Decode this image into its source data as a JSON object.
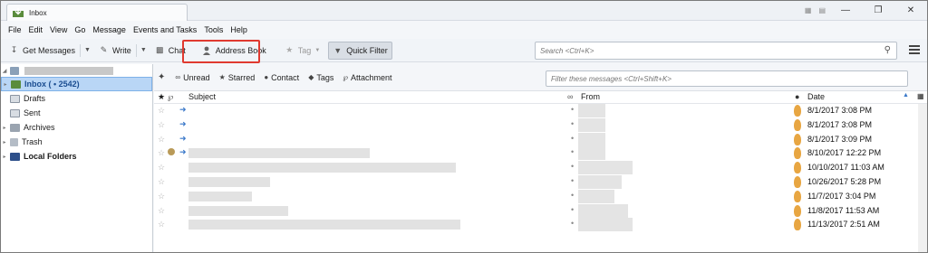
{
  "window": {
    "tab_title": "Inbox"
  },
  "menu": [
    "File",
    "Edit",
    "View",
    "Go",
    "Message",
    "Events and Tasks",
    "Tools",
    "Help"
  ],
  "toolbar": {
    "get_messages": "Get Messages",
    "write": "Write",
    "chat": "Chat",
    "address_book": "Address Book",
    "tag": "Tag",
    "quick_filter": "Quick Filter",
    "search_placeholder": "Search <Ctrl+K>"
  },
  "folders": {
    "inbox": "Inbox ( • 2542)",
    "drafts": "Drafts",
    "sent": "Sent",
    "archives": "Archives",
    "trash": "Trash",
    "local_folders": "Local Folders"
  },
  "quickfilter": {
    "unread": "Unread",
    "starred": "Starred",
    "contact": "Contact",
    "tags": "Tags",
    "attachment": "Attachment",
    "filter_placeholder": "Filter these messages <Ctrl+Shift+K>"
  },
  "columns": {
    "subject": "Subject",
    "from": "From",
    "date": "Date"
  },
  "messages": [
    {
      "date": "8/1/2017 3:08 PM"
    },
    {
      "date": "8/1/2017 3:08 PM"
    },
    {
      "date": "8/1/2017 3:09 PM"
    },
    {
      "date": "8/10/2017 12:22 PM"
    },
    {
      "date": "10/10/2017 11:03 AM"
    },
    {
      "date": "10/26/2017 5:28 PM"
    },
    {
      "date": "11/7/2017 3:04 PM"
    },
    {
      "date": "11/8/2017 11:53 AM"
    },
    {
      "date": "11/13/2017 2:51 AM"
    }
  ],
  "colors": {
    "selection": "#b9d6f6",
    "highlight_border": "#e03a30",
    "flame": "#e8a642",
    "forward_arrow": "#3a78c9"
  }
}
